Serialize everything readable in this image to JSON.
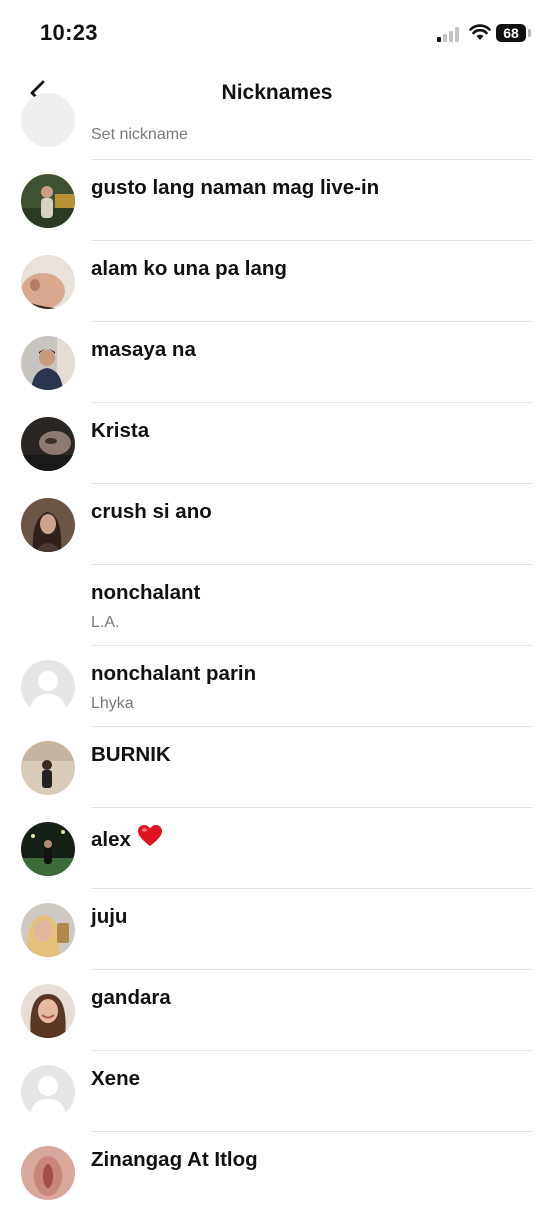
{
  "status_bar": {
    "time": "10:23",
    "battery": "68"
  },
  "header": {
    "title": "Nicknames"
  },
  "rows": [
    {
      "nickname": "",
      "subtitle": "Set nickname",
      "avatar": "light-gray"
    },
    {
      "nickname": "gusto lang naman mag live-in",
      "subtitle": "",
      "avatar": "photo-outdoor-green"
    },
    {
      "nickname": "alam ko una pa lang",
      "subtitle": "",
      "avatar": "photo-closeup-skin"
    },
    {
      "nickname": "masaya na",
      "subtitle": "",
      "avatar": "photo-person-indoor"
    },
    {
      "nickname": "Krista",
      "subtitle": "",
      "avatar": "photo-dark-face"
    },
    {
      "nickname": "crush si ano",
      "subtitle": "",
      "avatar": "photo-brown-portrait"
    },
    {
      "nickname": "nonchalant",
      "subtitle": "L.A.",
      "avatar": "none"
    },
    {
      "nickname": "nonchalant parin",
      "subtitle": "Lhyka",
      "avatar": "default-silhouette"
    },
    {
      "nickname": "BURNIK",
      "subtitle": "",
      "avatar": "photo-beige-room"
    },
    {
      "nickname": "alex",
      "subtitle": "",
      "avatar": "photo-night-field",
      "emoji": "heart-icon"
    },
    {
      "nickname": "juju",
      "subtitle": "",
      "avatar": "photo-blonde-selfie"
    },
    {
      "nickname": "gandara",
      "subtitle": "",
      "avatar": "photo-smiling-girl"
    },
    {
      "nickname": "Xene",
      "subtitle": "",
      "avatar": "default-silhouette"
    },
    {
      "nickname": "Zinangag At Itlog",
      "subtitle": "",
      "avatar": "photo-pink-closeup"
    }
  ]
}
